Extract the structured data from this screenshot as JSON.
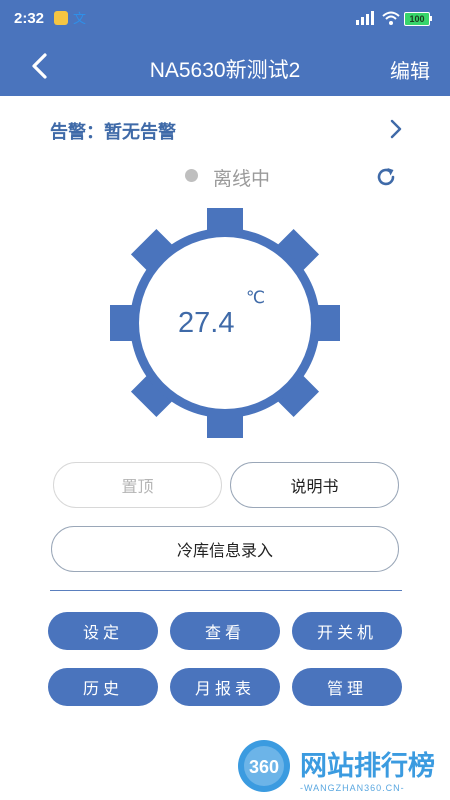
{
  "status_bar": {
    "time": "2:32",
    "battery": "100"
  },
  "header": {
    "title": "NA5630新测试2",
    "edit_label": "编辑"
  },
  "alarm": {
    "text": "告警：暂无告警"
  },
  "device": {
    "status": "离线中",
    "temperature": "27.4",
    "unit": "℃"
  },
  "actions": {
    "pin_label": "置顶",
    "manual_label": "说明书",
    "cold_storage_label": "冷库信息录入"
  },
  "buttons": [
    {
      "label": "设定"
    },
    {
      "label": "查看"
    },
    {
      "label": "开关机"
    },
    {
      "label": "历史"
    },
    {
      "label": "月报表"
    },
    {
      "label": "管理"
    }
  ],
  "watermark": {
    "name": "网站排行榜",
    "sub": "-WANGZHAN360.CN-"
  },
  "colors": {
    "primary": "#4a74bd",
    "offline_dot": "#bfbfbf"
  }
}
